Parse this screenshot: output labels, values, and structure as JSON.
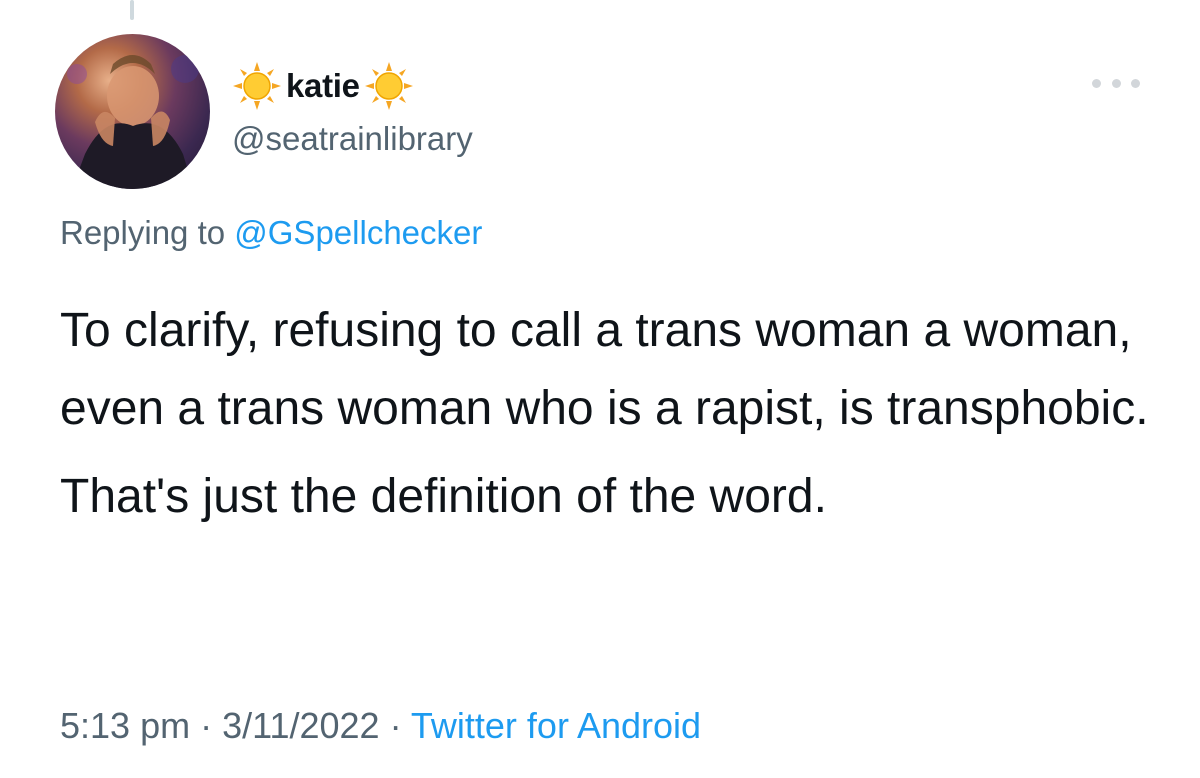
{
  "tweet": {
    "author": {
      "display_name": "katie",
      "name_emoji_left": "sun-with-face-icon",
      "name_emoji_right": "sun-with-face-icon",
      "handle": "@seatrainlibrary"
    },
    "reply": {
      "prefix": "Replying to ",
      "to_handle": "@GSpellchecker"
    },
    "text_paragraphs": [
      "To clarify, refusing to call a trans woman a woman, even a trans woman who is a rapist, is transphobic.",
      "That's just the definition of the word."
    ],
    "meta": {
      "time": "5:13 pm",
      "separator": " · ",
      "date": "3/11/2022",
      "source": "Twitter for Android"
    }
  },
  "colors": {
    "text_primary": "#0f1419",
    "text_secondary": "#536471",
    "link": "#1d9bf0",
    "more_dots": "#d2d6da"
  },
  "icons": {
    "more": "more-horizontal-icon"
  }
}
